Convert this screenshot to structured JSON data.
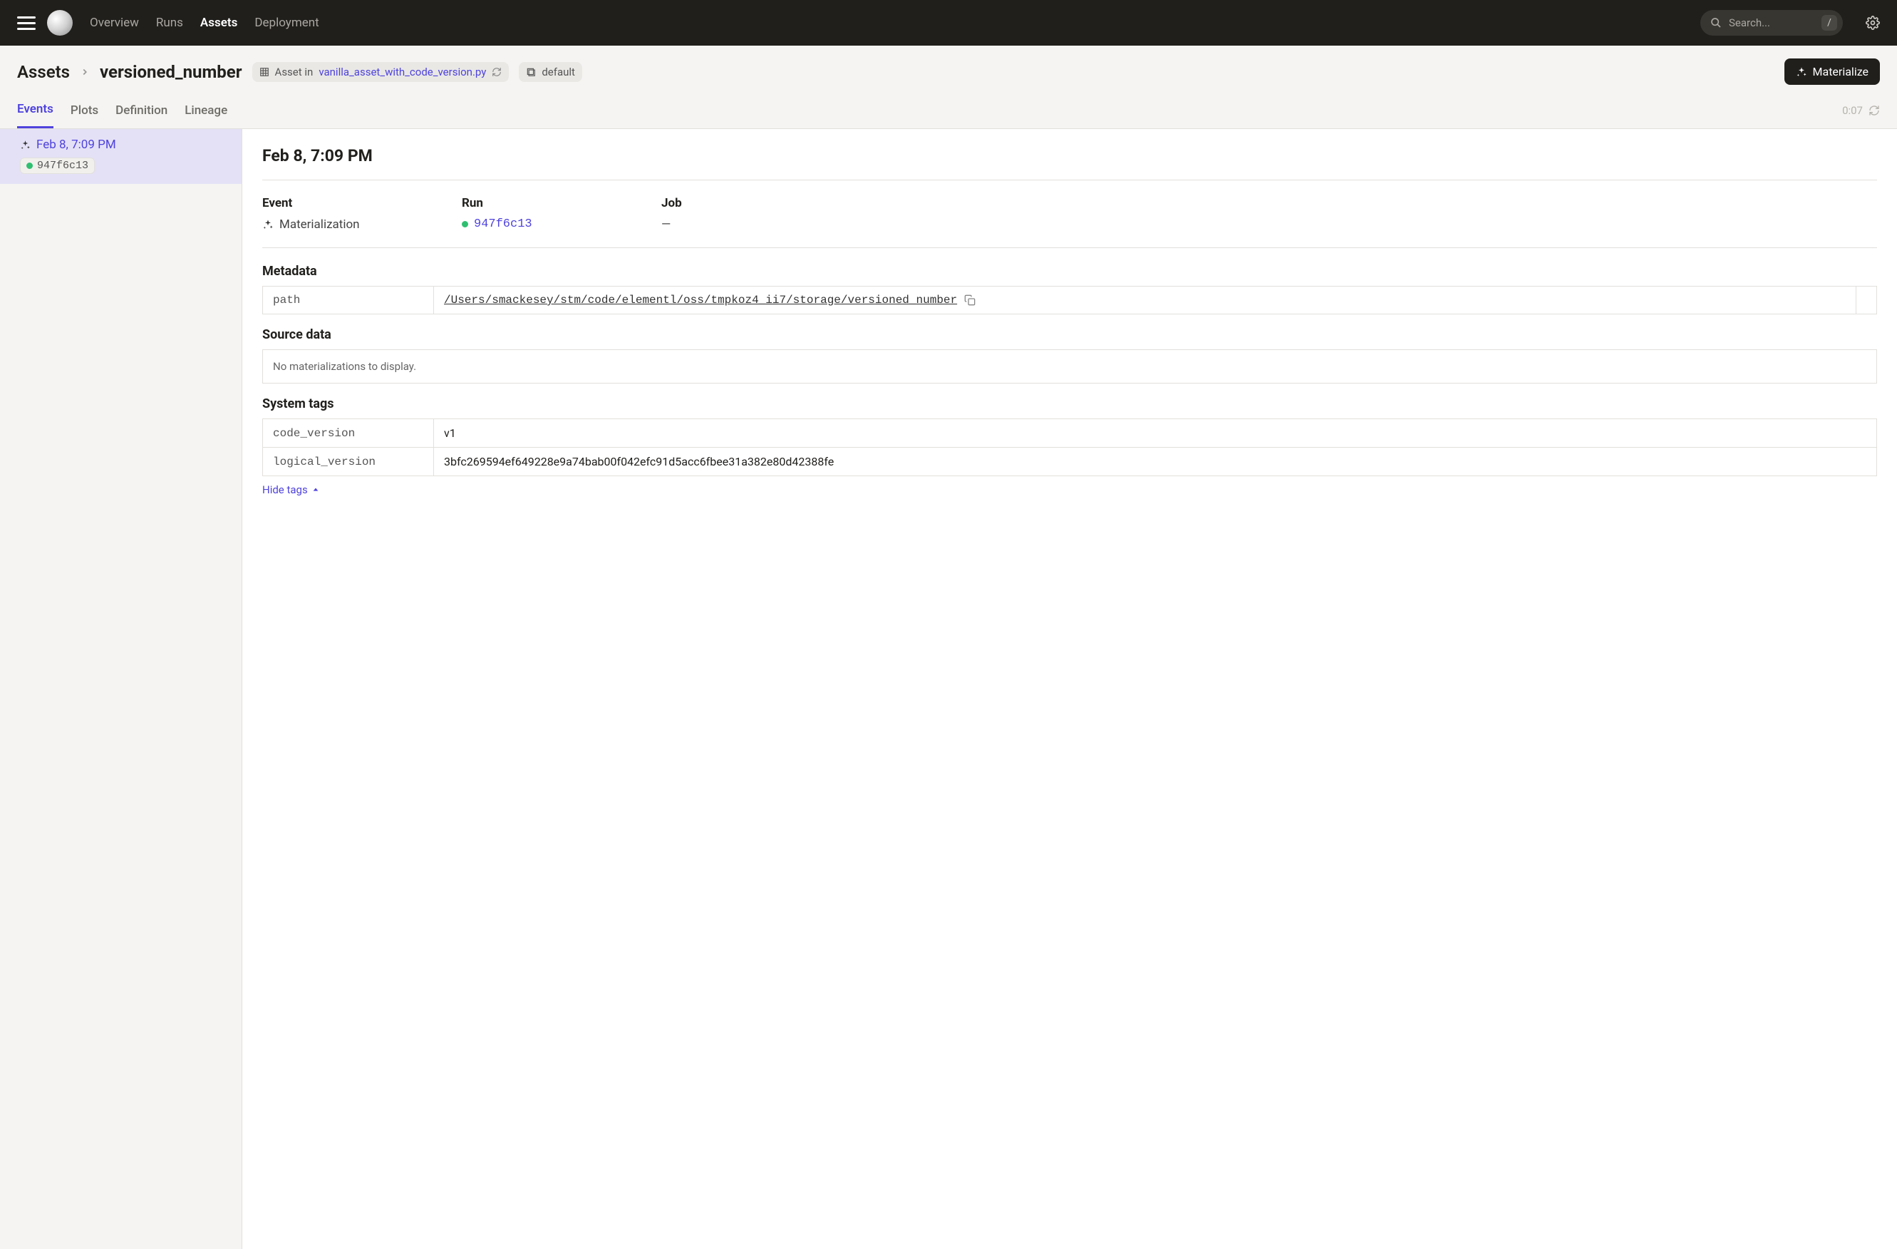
{
  "nav": {
    "links": [
      "Overview",
      "Runs",
      "Assets",
      "Deployment"
    ],
    "active": "Assets",
    "search_placeholder": "Search...",
    "search_key": "/"
  },
  "breadcrumb": {
    "root": "Assets",
    "leaf": "versioned_number",
    "asset_in_label": "Asset in",
    "asset_file": "vanilla_asset_with_code_version.py",
    "repo_chip": "default"
  },
  "materialize_label": "Materialize",
  "tabs": {
    "items": [
      "Events",
      "Plots",
      "Definition",
      "Lineage"
    ],
    "active": "Events",
    "timer": "0:07"
  },
  "sidebar": {
    "events": [
      {
        "time": "Feb 8, 7:09 PM",
        "run_id": "947f6c13"
      }
    ]
  },
  "detail": {
    "title": "Feb 8, 7:09 PM",
    "event_label": "Event",
    "event_value": "Materialization",
    "run_label": "Run",
    "run_id": "947f6c13",
    "job_label": "Job",
    "job_value": "—",
    "metadata_heading": "Metadata",
    "metadata": [
      {
        "key": "path",
        "value": "/Users/smackesey/stm/code/elementl/oss/tmpkoz4_ii7/storage/versioned_number"
      }
    ],
    "source_heading": "Source data",
    "source_empty": "No materializations to display.",
    "systags_heading": "System tags",
    "systags": [
      {
        "key": "code_version",
        "value": "v1"
      },
      {
        "key": "logical_version",
        "value": "3bfc269594ef649228e9a74bab00f042efc91d5acc6fbee31a382e80d42388fe"
      }
    ],
    "hide_tags": "Hide tags"
  }
}
